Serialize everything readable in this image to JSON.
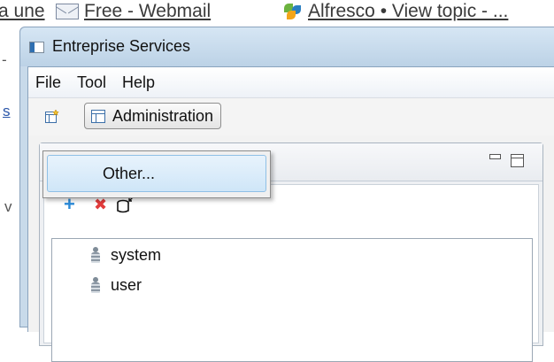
{
  "browser": {
    "tabs": [
      {
        "label": "a une"
      },
      {
        "label": "Free - Webmail"
      },
      {
        "label": "Alfresco • View topic - ..."
      }
    ],
    "remnants": {
      "dash": "-",
      "s": "s",
      "v": "v"
    }
  },
  "window": {
    "title": "Entreprise Services"
  },
  "menubar": {
    "items": [
      "File",
      "Tool",
      "Help"
    ]
  },
  "toolbar": {
    "perspective_label": "Administration"
  },
  "dropdown": {
    "items": [
      "Other..."
    ]
  },
  "tree": {
    "items": [
      "system",
      "user"
    ]
  },
  "colors": {
    "add_icon": "#2a8ad8",
    "remove_icon": "#e23b3b",
    "highlight": "#cfe6f8"
  }
}
